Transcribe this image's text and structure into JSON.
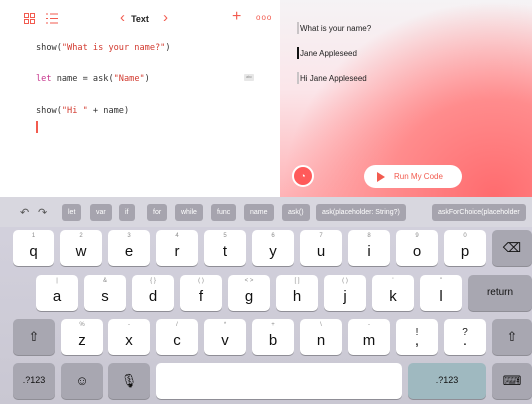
{
  "editor": {
    "title": "Text",
    "icons": {
      "grid": "grid-icon",
      "list": "list-icon",
      "back": "chevron-left-icon",
      "forward": "chevron-right-icon",
      "add": "plus-icon",
      "more": "ellipsis-icon"
    },
    "code": {
      "line1_fn": "show(",
      "line1_str": "\"What is your name?\"",
      "line1_end": ")",
      "line2_kw": "let",
      "line2_mid": " name = ask(",
      "line2_str": "\"Name\"",
      "line2_end": ")",
      "line2_chip": "abc",
      "line3_fn": "show(",
      "line3_str": "\"Hi \"",
      "line3_end": " + name)"
    }
  },
  "live_view": {
    "messages": [
      "What is your name?",
      "Jane Appleseed",
      "Hi Jane Appleseed"
    ],
    "run_button": "Run My Code",
    "accent": "#f25b4f"
  },
  "keyboard": {
    "suggestions": [
      "let",
      "var",
      "if",
      "for",
      "while",
      "func",
      "name",
      "ask()",
      "ask(placeholder: String?)",
      "askForChoice(placeholder"
    ],
    "row1": [
      {
        "sub": "1",
        "main": "q"
      },
      {
        "sub": "2",
        "main": "w"
      },
      {
        "sub": "3",
        "main": "e"
      },
      {
        "sub": "4",
        "main": "r"
      },
      {
        "sub": "5",
        "main": "t"
      },
      {
        "sub": "6",
        "main": "y"
      },
      {
        "sub": "7",
        "main": "u"
      },
      {
        "sub": "8",
        "main": "i"
      },
      {
        "sub": "9",
        "main": "o"
      },
      {
        "sub": "0",
        "main": "p"
      }
    ],
    "row2": [
      {
        "sub": "|",
        "main": "a"
      },
      {
        "sub": "&",
        "main": "s"
      },
      {
        "sub": "{ }",
        "main": "d"
      },
      {
        "sub": "( )",
        "main": "f"
      },
      {
        "sub": "< >",
        "main": "g"
      },
      {
        "sub": "[ ]",
        "main": "h"
      },
      {
        "sub": "( )",
        "main": "j"
      },
      {
        "sub": "'",
        "main": "k"
      },
      {
        "sub": "\"",
        "main": "l"
      }
    ],
    "row3": [
      {
        "sub": "%",
        "main": "z"
      },
      {
        "sub": "-",
        "main": "x"
      },
      {
        "sub": "/",
        "main": "c"
      },
      {
        "sub": "*",
        "main": "v"
      },
      {
        "sub": "+",
        "main": "b"
      },
      {
        "sub": "\\",
        "main": "n"
      },
      {
        "sub": "-",
        "main": "m"
      },
      {
        "sub": "!",
        "main": ","
      },
      {
        "sub": "?",
        "main": "."
      }
    ],
    "return_label": "return",
    "numbers_label": ".?123",
    "numbers_label_right": ".?123"
  }
}
